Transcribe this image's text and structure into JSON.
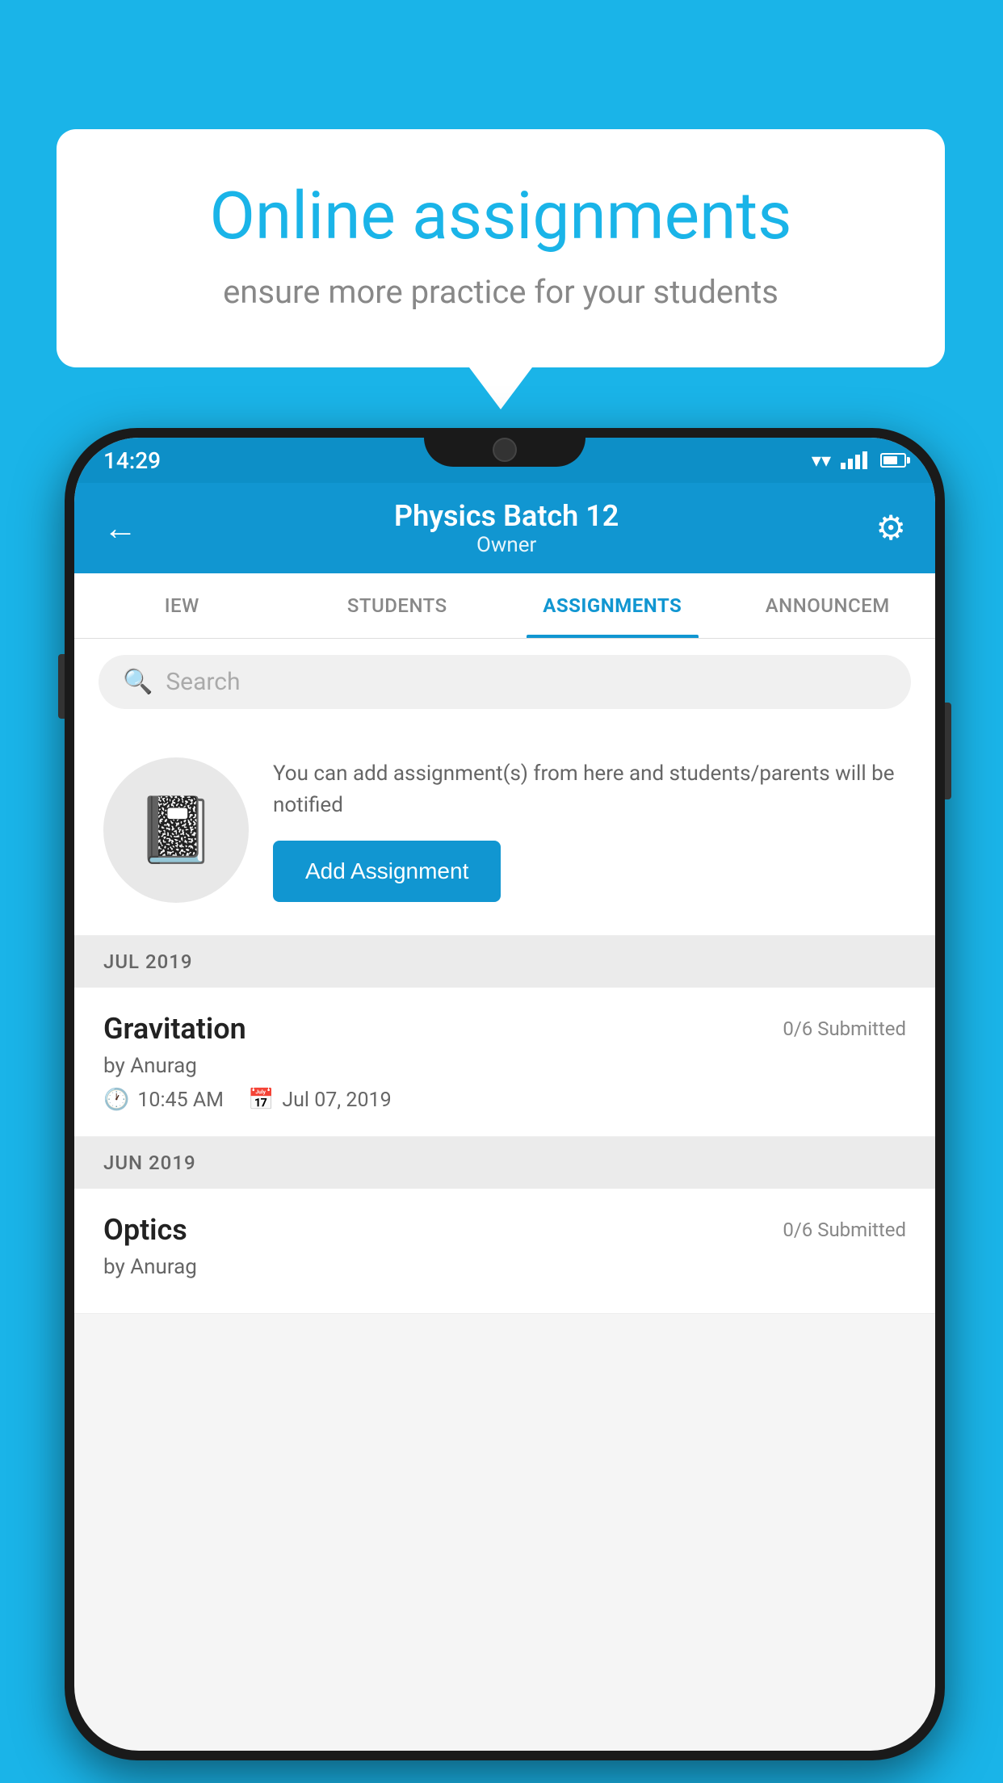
{
  "background_color": "#1ab4e8",
  "speech_bubble": {
    "title": "Online assignments",
    "subtitle": "ensure more practice for your students"
  },
  "phone": {
    "status_bar": {
      "time": "14:29"
    },
    "header": {
      "title": "Physics Batch 12",
      "subtitle": "Owner",
      "back_label": "←",
      "settings_label": "⚙"
    },
    "tabs": [
      {
        "label": "IEW",
        "active": false
      },
      {
        "label": "STUDENTS",
        "active": false
      },
      {
        "label": "ASSIGNMENTS",
        "active": true
      },
      {
        "label": "ANNOUNCEM",
        "active": false
      }
    ],
    "search": {
      "placeholder": "Search"
    },
    "promo": {
      "description": "You can add assignment(s) from here and students/parents will be notified",
      "button_label": "Add Assignment"
    },
    "months": [
      {
        "label": "JUL 2019",
        "assignments": [
          {
            "name": "Gravitation",
            "submitted": "0/6 Submitted",
            "by": "by Anurag",
            "time": "10:45 AM",
            "date": "Jul 07, 2019"
          }
        ]
      },
      {
        "label": "JUN 2019",
        "assignments": [
          {
            "name": "Optics",
            "submitted": "0/6 Submitted",
            "by": "by Anurag"
          }
        ]
      }
    ]
  }
}
